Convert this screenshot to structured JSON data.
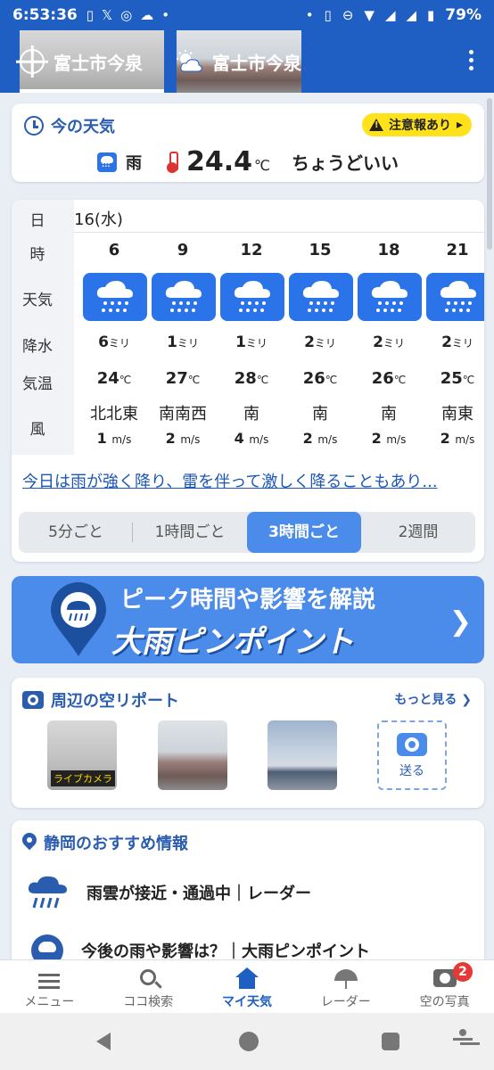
{
  "status": {
    "time": "6:53:36",
    "battery": "79%"
  },
  "header": {
    "tabs": [
      {
        "label": "富士市今泉",
        "icon": "current-location-icon"
      },
      {
        "label": "富士市今泉",
        "icon": "partly-cloudy-icon"
      }
    ]
  },
  "now": {
    "title": "今の天気",
    "alert": "注意報あり",
    "condition": "雨",
    "temp": "24.4",
    "temp_unit": "℃",
    "feel": "ちょうどいい"
  },
  "forecast": {
    "labels": {
      "day": "日",
      "hour": "時",
      "weather": "天気",
      "precip": "降水",
      "temp": "気温",
      "wind": "風"
    },
    "day": "16(水)",
    "cols": [
      {
        "hour": "6",
        "weather": "rain",
        "precip": "6",
        "temp": "24",
        "wdir": "北北東",
        "wspd": "1"
      },
      {
        "hour": "9",
        "weather": "rain",
        "precip": "1",
        "temp": "27",
        "wdir": "南南西",
        "wspd": "2"
      },
      {
        "hour": "12",
        "weather": "rain",
        "precip": "1",
        "temp": "28",
        "wdir": "南",
        "wspd": "4"
      },
      {
        "hour": "15",
        "weather": "rain",
        "precip": "2",
        "temp": "26",
        "wdir": "南",
        "wspd": "2"
      },
      {
        "hour": "18",
        "weather": "rain",
        "precip": "2",
        "temp": "26",
        "wdir": "南",
        "wspd": "2"
      },
      {
        "hour": "21",
        "weather": "rain",
        "precip": "2",
        "temp": "25",
        "wdir": "南東",
        "wspd": "2"
      }
    ],
    "units": {
      "precip": "ミリ",
      "temp": "℃",
      "wind": "m/s"
    },
    "comment": "今日は雨が強く降り、雷を伴って激しく降ることもあり...",
    "segments": [
      "5分ごと",
      "1時間ごと",
      "3時間ごと",
      "2週間"
    ],
    "active_segment": "3時間ごと"
  },
  "banner": {
    "line1": "ピーク時間や影響を解説",
    "line2": "大雨ピンポイント"
  },
  "sky": {
    "title": "周辺の空リポート",
    "more": "もっと見る",
    "thumb_label": "ライブカメラ",
    "send": "送る"
  },
  "rec": {
    "title": "静岡のおすすめ情報",
    "items": [
      "雨雲が接近・通過中｜レーダー",
      "今後の雨や影響は？｜大雨ピンポイント"
    ]
  },
  "nav": {
    "items": [
      "メニュー",
      "ココ検索",
      "マイ天気",
      "レーダー",
      "空の写真"
    ],
    "active": "マイ天気",
    "photo_badge": "2"
  },
  "colors": {
    "primary": "#1f5fc3",
    "accent": "#4b8bea",
    "alert": "#ffe21a"
  }
}
